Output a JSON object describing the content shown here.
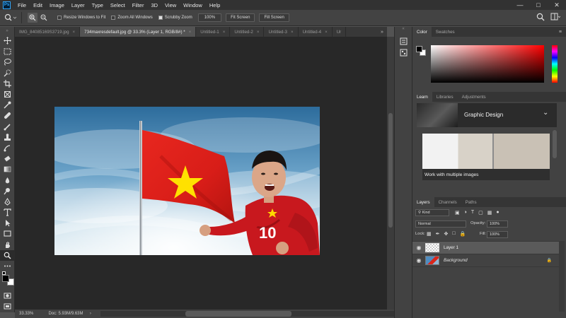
{
  "menu": {
    "app_logo": "Ps",
    "items": [
      "File",
      "Edit",
      "Image",
      "Layer",
      "Type",
      "Select",
      "Filter",
      "3D",
      "View",
      "Window",
      "Help"
    ],
    "controls": [
      "minimize",
      "maximize",
      "close"
    ]
  },
  "options_bar": {
    "checkboxes": [
      {
        "label": "Resize Windows to Fit",
        "checked": false
      },
      {
        "label": "Zoom All Windows",
        "checked": false
      },
      {
        "label": "Scrubby Zoom",
        "checked": true
      }
    ],
    "zoom_value": "100%",
    "fit_screen": "Fit Screen",
    "fill_screen": "Fill Screen"
  },
  "tabs": [
    {
      "label": "IMG_84085169S3719.jpg",
      "active": false
    },
    {
      "label": "734maxresdefault.jpg @ 33.3% (Layer 1, RGB/8#) *",
      "active": true
    },
    {
      "label": "Untitled-1",
      "active": false
    },
    {
      "label": "Untitled-2",
      "active": false
    },
    {
      "label": "Untitled-3",
      "active": false
    },
    {
      "label": "Untitled-4",
      "active": false
    },
    {
      "label": "Ur",
      "active": false
    }
  ],
  "status": {
    "zoom": "33.33%",
    "doc": "Doc: 5.93M/9.63M"
  },
  "color_panel": {
    "tabs": [
      "Color",
      "Swatches"
    ],
    "foreground": "#000000",
    "background": "#ffffff",
    "hue_color": "#ff0000"
  },
  "learn_panel": {
    "tabs": [
      "Learn",
      "Libraries",
      "Adjustments"
    ],
    "section_title": "Graphic Design",
    "card_title": "Work with multiple images"
  },
  "layers_panel": {
    "tabs": [
      "Layers",
      "Channels",
      "Paths"
    ],
    "kind_label": "Kind",
    "blend_mode": "Normal",
    "opacity_label": "Opacity:",
    "opacity_value": "100%",
    "lock_label": "Lock:",
    "fill_label": "Fill:",
    "fill_value": "100%",
    "layers": [
      {
        "name": "Layer 1",
        "selected": true
      },
      {
        "name": "Background",
        "selected": false
      }
    ]
  },
  "photo": {
    "jersey_number": "10"
  }
}
